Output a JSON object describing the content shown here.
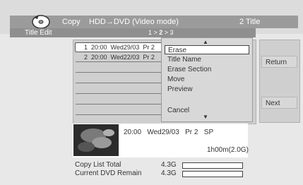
{
  "header": {
    "section": "Copy",
    "mode": "HDD→DVD (Video mode)",
    "count": "2 Title"
  },
  "subheader": {
    "title": "Title Edit",
    "pager_prefix": "1 > ",
    "pager_current": "2",
    "pager_suffix": " > 3"
  },
  "titles": [
    {
      "text": "1  20:00  Wed29/03  Pr 2"
    },
    {
      "text": "2  20:00  Wed22/03  Pr 2"
    }
  ],
  "menu": {
    "items": [
      "Erase",
      "Title Name",
      "Erase Section",
      "Move",
      "Preview",
      "Cancel"
    ],
    "selected_index": 0
  },
  "side_buttons": [
    "Return",
    "Next"
  ],
  "preview": {
    "info": "20:00   Wed29/03   Pr 2   SP",
    "duration": "1h00m(2.0G)"
  },
  "stats": [
    {
      "label": "Copy List Total",
      "value": "4.3G"
    },
    {
      "label": "Current DVD Remain",
      "value": "4.3G"
    }
  ]
}
